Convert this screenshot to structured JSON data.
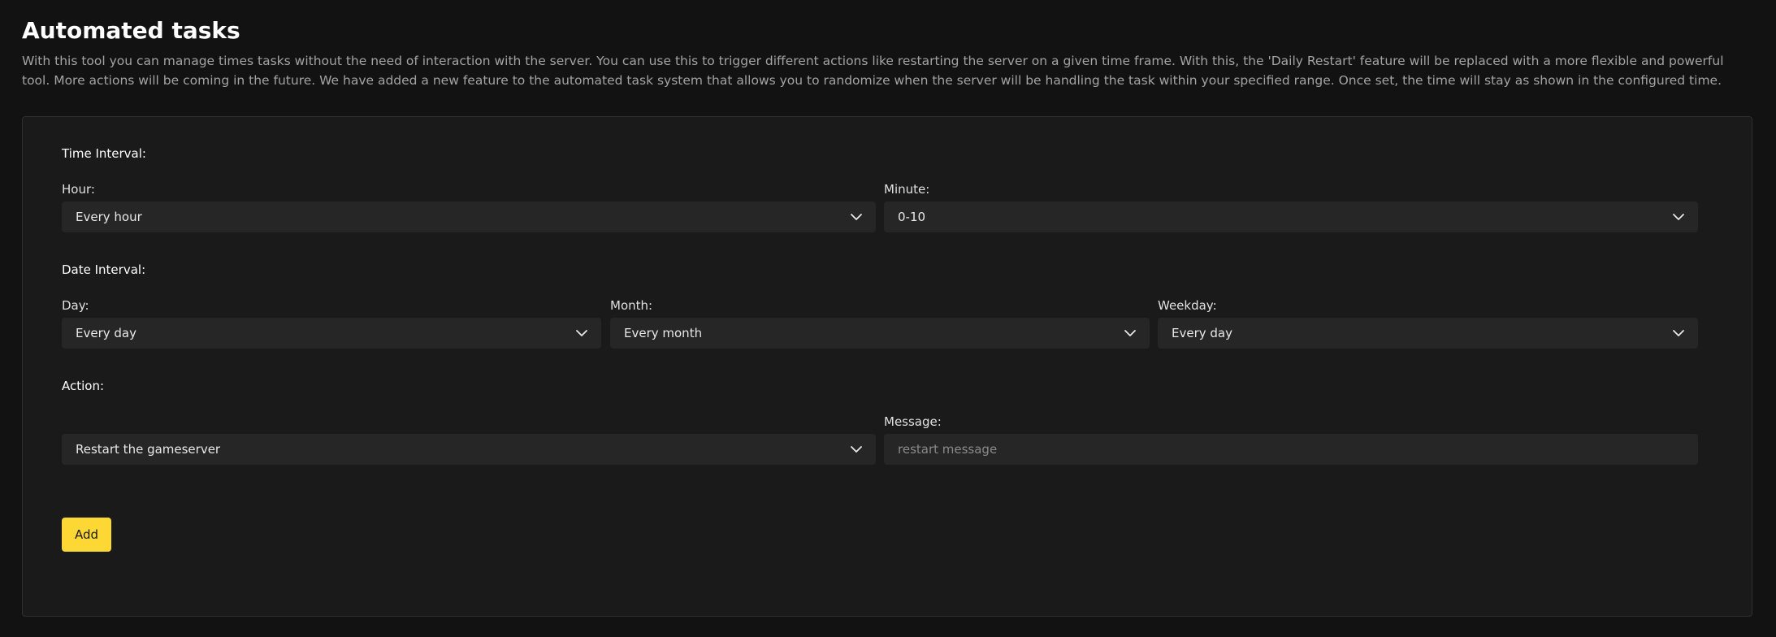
{
  "header": {
    "title": "Automated tasks",
    "description": "With this tool you can manage times tasks without the need of interaction with the server. You can use this to trigger different actions like restarting the server on a given time frame. With this, the 'Daily Restart' feature will be replaced with a more flexible and powerful tool. More actions will be coming in the future. We have added a new feature to the automated task system that allows you to randomize when the server will be handling the task within your specified range. Once set, the time will stay as shown in the configured time."
  },
  "time_interval": {
    "label": "Time Interval:",
    "hour": {
      "label": "Hour:",
      "value": "Every hour"
    },
    "minute": {
      "label": "Minute:",
      "value": "0-10"
    }
  },
  "date_interval": {
    "label": "Date Interval:",
    "day": {
      "label": "Day:",
      "value": "Every day"
    },
    "month": {
      "label": "Month:",
      "value": "Every month"
    },
    "weekday": {
      "label": "Weekday:",
      "value": "Every day"
    }
  },
  "action": {
    "label": "Action:",
    "value": "Restart the gameserver",
    "message": {
      "label": "Message:",
      "placeholder": "restart message",
      "value": ""
    }
  },
  "buttons": {
    "add_label": "Add"
  },
  "icons": {
    "dropdown": "chevron-down-icon"
  },
  "colors": {
    "background": "#121212",
    "card": "#1a1a1a",
    "field": "#262626",
    "accent": "#fdd835"
  }
}
